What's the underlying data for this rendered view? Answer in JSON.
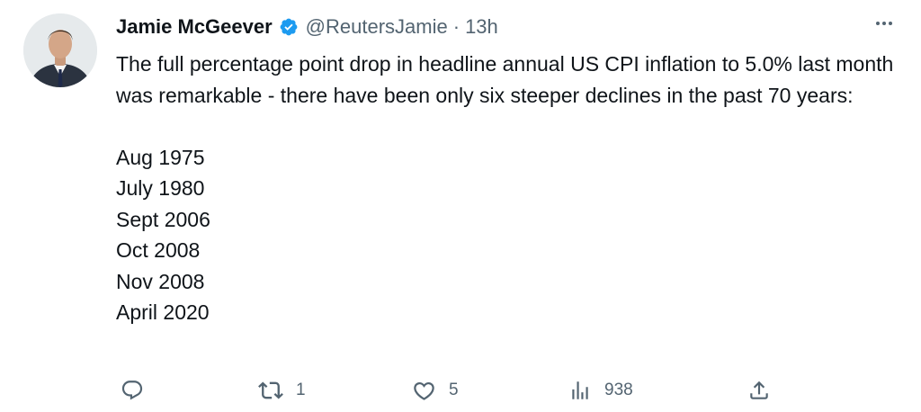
{
  "tweet": {
    "author": {
      "display_name": "Jamie McGeever",
      "handle": "@ReutersJamie",
      "separator": "·",
      "time": "13h",
      "verified_color": "#1d9bf0"
    },
    "text": {
      "paragraph_1": "The full percentage point drop in headline annual US CPI inflation to 5.0% last month was remarkable - there have been only six steeper declines in the past 70 years:",
      "dates": [
        "Aug 1975",
        "July 1980",
        "Sept 2006",
        "Oct 2008",
        "Nov 2008",
        "April 2020"
      ]
    },
    "actions": {
      "reply_count": "",
      "retweet_count": "1",
      "like_count": "5",
      "views_count": "938"
    },
    "icons": {
      "more": "more-horizontal-icon",
      "reply": "reply-icon",
      "retweet": "retweet-icon",
      "like": "heart-icon",
      "views": "views-icon",
      "share": "share-icon",
      "verified": "verified-badge-icon"
    },
    "colors": {
      "text": "#0f1419",
      "secondary": "#536471",
      "accent": "#1d9bf0"
    }
  }
}
